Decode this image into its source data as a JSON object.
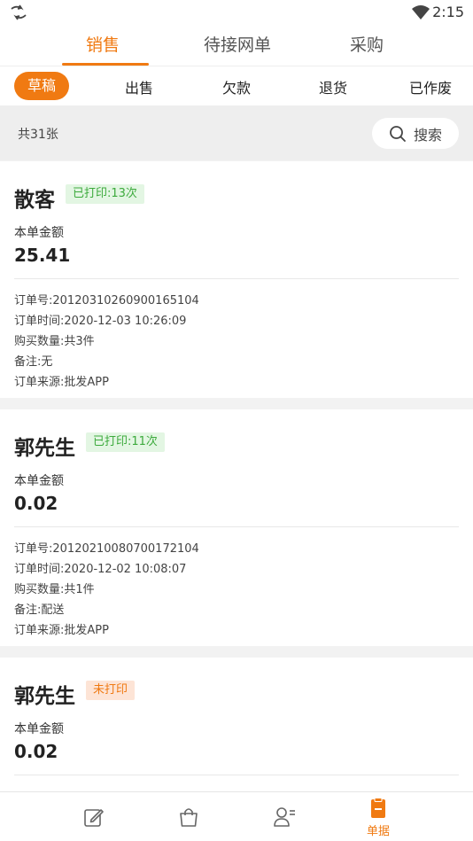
{
  "status_bar": {
    "time": "2:15"
  },
  "top_tabs": [
    {
      "label": "销售"
    },
    {
      "label": "待接网单"
    },
    {
      "label": "采购"
    }
  ],
  "sub_tabs": [
    {
      "label": "草稿"
    },
    {
      "label": "出售"
    },
    {
      "label": "欠款"
    },
    {
      "label": "退货"
    },
    {
      "label": "已作废"
    }
  ],
  "list": {
    "count_text": "共31张",
    "search_label": "搜索"
  },
  "orders": [
    {
      "customer": "散客",
      "print_status": "已打印:13次",
      "amount_label": "本单金额",
      "amount": "25.41",
      "order_no": "订单号:20120310260900165104",
      "order_time": "订单时间:2020-12-03 10:26:09",
      "quantity": "购买数量:共3件",
      "remark": "备注:无",
      "source": "订单来源:批发APP"
    },
    {
      "customer": "郭先生",
      "print_status": "已打印:11次",
      "amount_label": "本单金额",
      "amount": "0.02",
      "order_no": "订单号:20120210080700172104",
      "order_time": "订单时间:2020-12-02 10:08:07",
      "quantity": "购买数量:共1件",
      "remark": "备注:配送",
      "source": "订单来源:批发APP"
    },
    {
      "customer": "郭先生",
      "print_status": "未打印",
      "amount_label": "本单金额",
      "amount": "0.02"
    }
  ],
  "bottom_nav": {
    "items": [
      {
        "icon": "edit-icon"
      },
      {
        "icon": "shopping-bag-icon"
      },
      {
        "icon": "customer-list-icon"
      },
      {
        "icon": "document-icon",
        "label": "单据"
      }
    ]
  },
  "colors": {
    "accent": "#f07a12",
    "printed_badge_bg": "#e3f6e3",
    "printed_badge_text": "#3caa3c",
    "unprinted_badge_bg": "#fde4d6"
  }
}
